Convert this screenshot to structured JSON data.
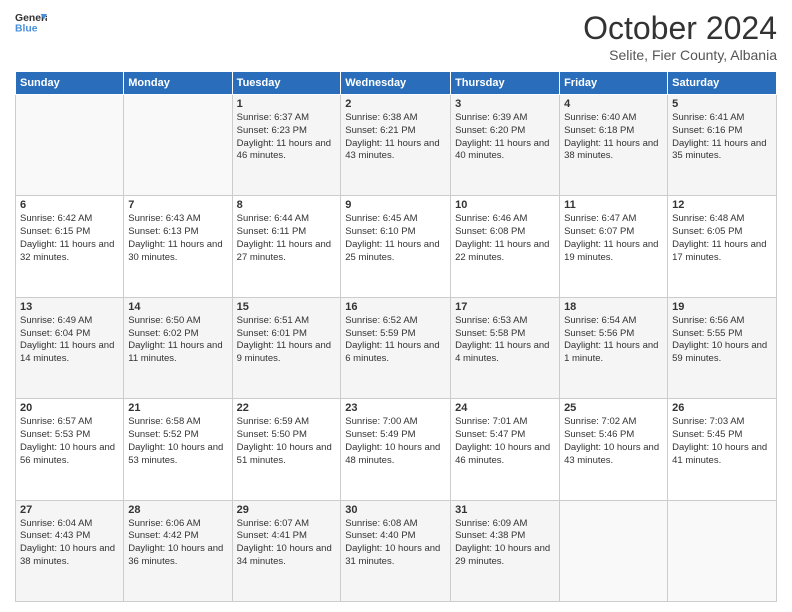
{
  "header": {
    "logo": {
      "line1": "General",
      "line2": "Blue"
    },
    "title": "October 2024",
    "subtitle": "Selite, Fier County, Albania"
  },
  "days_of_week": [
    "Sunday",
    "Monday",
    "Tuesday",
    "Wednesday",
    "Thursday",
    "Friday",
    "Saturday"
  ],
  "weeks": [
    [
      {
        "day": "",
        "info": ""
      },
      {
        "day": "",
        "info": ""
      },
      {
        "day": "1",
        "info": "Sunrise: 6:37 AM\nSunset: 6:23 PM\nDaylight: 11 hours and 46 minutes."
      },
      {
        "day": "2",
        "info": "Sunrise: 6:38 AM\nSunset: 6:21 PM\nDaylight: 11 hours and 43 minutes."
      },
      {
        "day": "3",
        "info": "Sunrise: 6:39 AM\nSunset: 6:20 PM\nDaylight: 11 hours and 40 minutes."
      },
      {
        "day": "4",
        "info": "Sunrise: 6:40 AM\nSunset: 6:18 PM\nDaylight: 11 hours and 38 minutes."
      },
      {
        "day": "5",
        "info": "Sunrise: 6:41 AM\nSunset: 6:16 PM\nDaylight: 11 hours and 35 minutes."
      }
    ],
    [
      {
        "day": "6",
        "info": "Sunrise: 6:42 AM\nSunset: 6:15 PM\nDaylight: 11 hours and 32 minutes."
      },
      {
        "day": "7",
        "info": "Sunrise: 6:43 AM\nSunset: 6:13 PM\nDaylight: 11 hours and 30 minutes."
      },
      {
        "day": "8",
        "info": "Sunrise: 6:44 AM\nSunset: 6:11 PM\nDaylight: 11 hours and 27 minutes."
      },
      {
        "day": "9",
        "info": "Sunrise: 6:45 AM\nSunset: 6:10 PM\nDaylight: 11 hours and 25 minutes."
      },
      {
        "day": "10",
        "info": "Sunrise: 6:46 AM\nSunset: 6:08 PM\nDaylight: 11 hours and 22 minutes."
      },
      {
        "day": "11",
        "info": "Sunrise: 6:47 AM\nSunset: 6:07 PM\nDaylight: 11 hours and 19 minutes."
      },
      {
        "day": "12",
        "info": "Sunrise: 6:48 AM\nSunset: 6:05 PM\nDaylight: 11 hours and 17 minutes."
      }
    ],
    [
      {
        "day": "13",
        "info": "Sunrise: 6:49 AM\nSunset: 6:04 PM\nDaylight: 11 hours and 14 minutes."
      },
      {
        "day": "14",
        "info": "Sunrise: 6:50 AM\nSunset: 6:02 PM\nDaylight: 11 hours and 11 minutes."
      },
      {
        "day": "15",
        "info": "Sunrise: 6:51 AM\nSunset: 6:01 PM\nDaylight: 11 hours and 9 minutes."
      },
      {
        "day": "16",
        "info": "Sunrise: 6:52 AM\nSunset: 5:59 PM\nDaylight: 11 hours and 6 minutes."
      },
      {
        "day": "17",
        "info": "Sunrise: 6:53 AM\nSunset: 5:58 PM\nDaylight: 11 hours and 4 minutes."
      },
      {
        "day": "18",
        "info": "Sunrise: 6:54 AM\nSunset: 5:56 PM\nDaylight: 11 hours and 1 minute."
      },
      {
        "day": "19",
        "info": "Sunrise: 6:56 AM\nSunset: 5:55 PM\nDaylight: 10 hours and 59 minutes."
      }
    ],
    [
      {
        "day": "20",
        "info": "Sunrise: 6:57 AM\nSunset: 5:53 PM\nDaylight: 10 hours and 56 minutes."
      },
      {
        "day": "21",
        "info": "Sunrise: 6:58 AM\nSunset: 5:52 PM\nDaylight: 10 hours and 53 minutes."
      },
      {
        "day": "22",
        "info": "Sunrise: 6:59 AM\nSunset: 5:50 PM\nDaylight: 10 hours and 51 minutes."
      },
      {
        "day": "23",
        "info": "Sunrise: 7:00 AM\nSunset: 5:49 PM\nDaylight: 10 hours and 48 minutes."
      },
      {
        "day": "24",
        "info": "Sunrise: 7:01 AM\nSunset: 5:47 PM\nDaylight: 10 hours and 46 minutes."
      },
      {
        "day": "25",
        "info": "Sunrise: 7:02 AM\nSunset: 5:46 PM\nDaylight: 10 hours and 43 minutes."
      },
      {
        "day": "26",
        "info": "Sunrise: 7:03 AM\nSunset: 5:45 PM\nDaylight: 10 hours and 41 minutes."
      }
    ],
    [
      {
        "day": "27",
        "info": "Sunrise: 6:04 AM\nSunset: 4:43 PM\nDaylight: 10 hours and 38 minutes."
      },
      {
        "day": "28",
        "info": "Sunrise: 6:06 AM\nSunset: 4:42 PM\nDaylight: 10 hours and 36 minutes."
      },
      {
        "day": "29",
        "info": "Sunrise: 6:07 AM\nSunset: 4:41 PM\nDaylight: 10 hours and 34 minutes."
      },
      {
        "day": "30",
        "info": "Sunrise: 6:08 AM\nSunset: 4:40 PM\nDaylight: 10 hours and 31 minutes."
      },
      {
        "day": "31",
        "info": "Sunrise: 6:09 AM\nSunset: 4:38 PM\nDaylight: 10 hours and 29 minutes."
      },
      {
        "day": "",
        "info": ""
      },
      {
        "day": "",
        "info": ""
      }
    ]
  ]
}
